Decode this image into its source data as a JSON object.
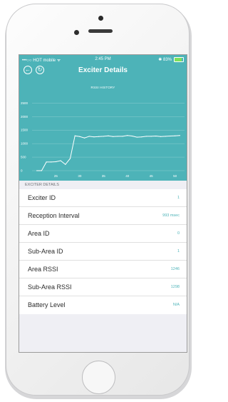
{
  "status_bar": {
    "carrier": "•••○○ HOT mobile ᯤ",
    "time": "2:45 PM",
    "battery": "✱ 83%"
  },
  "nav": {
    "title": "Exciter Details",
    "back_icon": "back-arrow-icon",
    "refresh_icon": "refresh-icon"
  },
  "colors": {
    "accent": "#4db3b8",
    "background": "#efeff4",
    "value": "#4db3b8"
  },
  "chart_data": {
    "type": "line",
    "title": "RSSI HISTORY",
    "xlabel": "",
    "ylabel": "",
    "x": [
      21,
      22,
      23,
      24,
      25,
      26,
      27,
      28,
      29,
      30,
      31,
      32,
      33,
      34,
      35,
      36,
      37,
      38,
      39,
      40,
      41,
      42,
      43,
      44,
      45,
      46,
      47,
      48,
      49,
      50,
      51
    ],
    "y": [
      0,
      0,
      320,
      320,
      330,
      370,
      230,
      450,
      1290,
      1260,
      1210,
      1270,
      1250,
      1260,
      1270,
      1290,
      1260,
      1270,
      1270,
      1300,
      1280,
      1240,
      1250,
      1270,
      1270,
      1280,
      1260,
      1270,
      1280,
      1290,
      1300
    ],
    "xticks": [
      "25",
      "30",
      "35",
      "40",
      "45",
      "50"
    ],
    "yticks": [
      "0",
      "500",
      "1000",
      "1500",
      "2000",
      "2500"
    ],
    "xlim": [
      20,
      52
    ],
    "ylim": [
      0,
      2800
    ],
    "grid": true
  },
  "section_header": "EXCITER DETAILS",
  "rows": [
    {
      "label": "Exciter ID",
      "value": "1"
    },
    {
      "label": "Reception Interval",
      "value": "993 msec"
    },
    {
      "label": "Area ID",
      "value": "0"
    },
    {
      "label": "Sub-Area ID",
      "value": "1"
    },
    {
      "label": "Area RSSI",
      "value": "1246"
    },
    {
      "label": "Sub-Area RSSI",
      "value": "1298"
    },
    {
      "label": "Battery Level",
      "value": "N/A"
    }
  ]
}
